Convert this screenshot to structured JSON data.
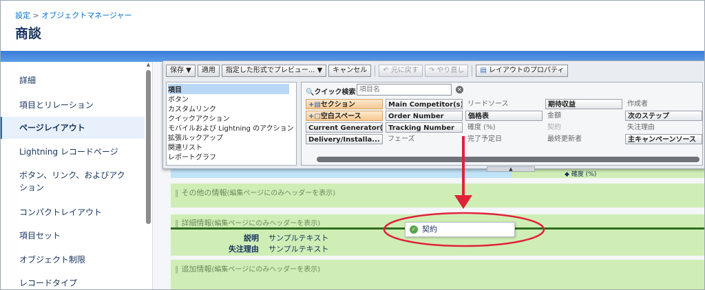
{
  "header": {
    "breadcrumb_root": "設定",
    "breadcrumb_sep": ">",
    "breadcrumb_current": "オブジェクトマネージャー",
    "title": "商談"
  },
  "sidebar": {
    "items": [
      {
        "label": "詳細"
      },
      {
        "label": "項目とリレーション"
      },
      {
        "label": "ページレイアウト"
      },
      {
        "label": "Lightning レコードページ"
      },
      {
        "label": "ボタン、リンク、およびアク"
      },
      {
        "label": "ション"
      },
      {
        "label": "コンパクトレイアウト"
      },
      {
        "label": "項目セット"
      },
      {
        "label": "オブジェクト制限"
      },
      {
        "label": "レコードタイプ"
      }
    ],
    "active_index": 2
  },
  "toolbar": {
    "save": "保存 ▼",
    "apply": "適用",
    "preview": "指定した形式でプレビュー... ▼",
    "cancel": "キャンセル",
    "undo": "元に戻す",
    "redo": "やり直し",
    "layout_props": "レイアウトのプロパティ"
  },
  "categories": [
    "項目",
    "ボタン",
    "カスタムリンク",
    "クイックアクション",
    "モバイルおよび Lightning のアクション",
    "拡張ルックアップ",
    "関連リスト",
    "レポートグラフ"
  ],
  "quick_search": {
    "label": "クイック検索",
    "placeholder": "項目名"
  },
  "palette_rows": [
    [
      "セクション",
      "Main Competitor(s)",
      "リードソース",
      "期待収益",
      "作成者"
    ],
    [
      "空白スペース",
      "Order Number",
      "価格表",
      "金額",
      "次のステップ"
    ],
    [
      "Current Generator(s)",
      "Tracking Number",
      "確度 (%)",
      "契約",
      "失注理由"
    ],
    [
      "Delivery/Installa...",
      "フェーズ",
      "完了予定日",
      "最終更新者",
      "主キャンペーンソース"
    ]
  ],
  "sections": {
    "other": {
      "title": "その他の情報",
      "hint": "(編集ページにのみヘッダーを表示)"
    },
    "detail": {
      "title": "詳細情報",
      "hint": "(編集ページにのみヘッダーを表示)"
    },
    "additional": {
      "title": "追加情報",
      "hint": "(編集ページにのみヘッダーを表示)"
    }
  },
  "detail_fields": [
    {
      "label": "説明",
      "value": "サンプルテキスト"
    },
    {
      "label": "失注理由",
      "value": "サンプルテキスト"
    }
  ],
  "partial_row": {
    "label": "確度 (%)"
  },
  "drag_item": {
    "label": "契約"
  },
  "colors": {
    "accent": "#0070d2",
    "section": "#cfeeb5",
    "annotation": "#e0223a"
  }
}
